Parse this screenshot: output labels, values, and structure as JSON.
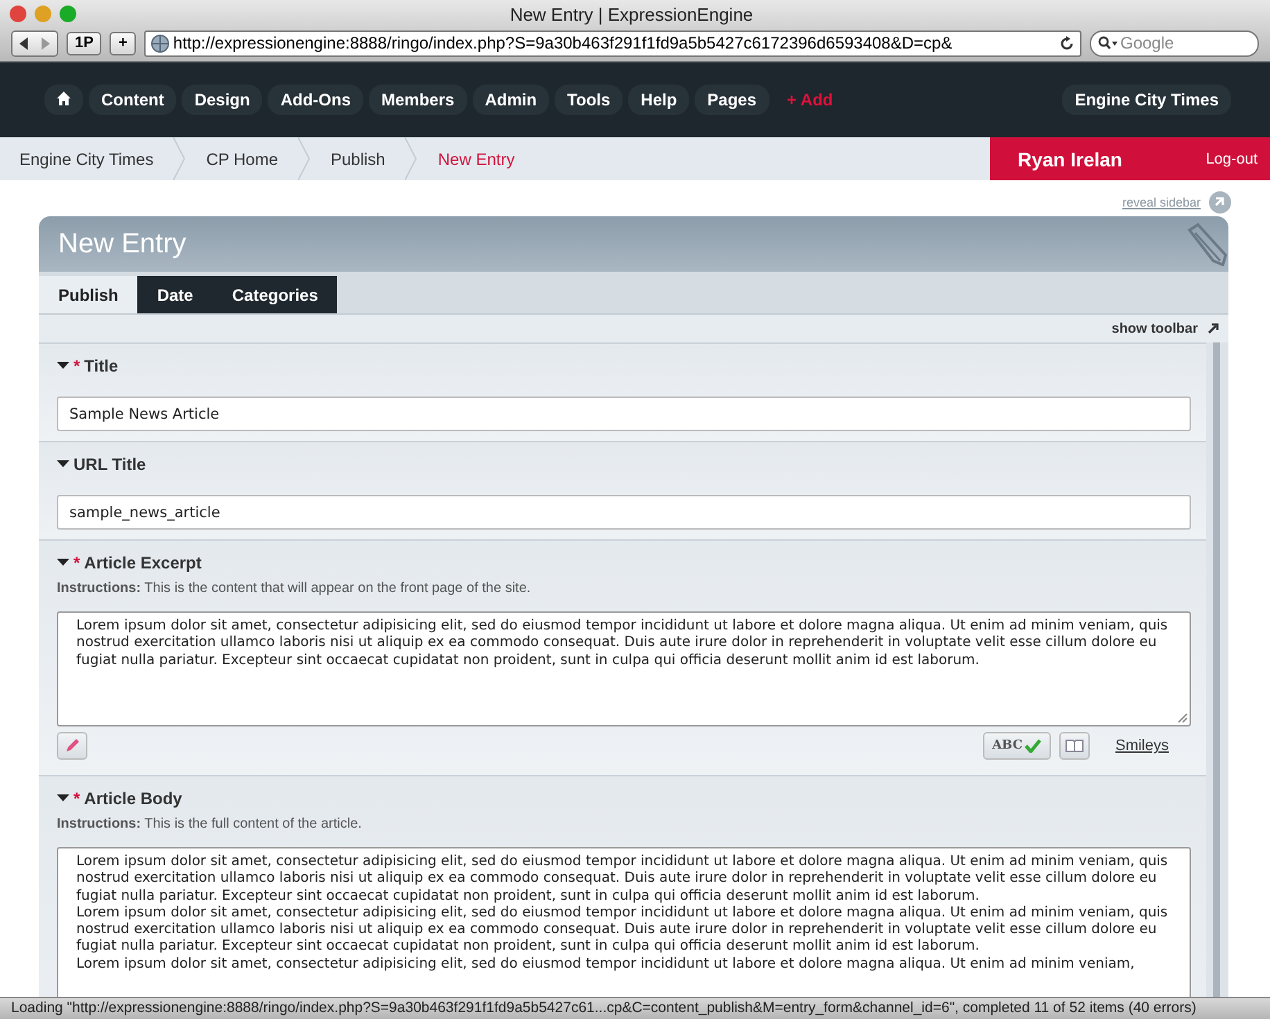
{
  "window": {
    "title": "New Entry | ExpressionEngine",
    "url": "http://expressionengine:8888/ringo/index.php?S=9a30b463f291f1fd9a5b5427c6172396d6593408&D=cp&",
    "bookmark": "1P",
    "plus": "+",
    "search_placeholder": "Google"
  },
  "nav": {
    "items": [
      {
        "kind": "home"
      },
      {
        "kind": "link",
        "label": "Content"
      },
      {
        "kind": "link",
        "label": "Design"
      },
      {
        "kind": "link",
        "label": "Add-Ons"
      },
      {
        "kind": "link",
        "label": "Members"
      },
      {
        "kind": "link",
        "label": "Admin"
      },
      {
        "kind": "link",
        "label": "Tools"
      },
      {
        "kind": "link",
        "label": "Help"
      },
      {
        "kind": "link",
        "label": "Pages"
      },
      {
        "kind": "add",
        "label": "+ Add"
      }
    ],
    "site": "Engine City Times"
  },
  "breadcrumbs": [
    {
      "label": "Engine City Times",
      "selected": false
    },
    {
      "label": "CP Home",
      "selected": false
    },
    {
      "label": "Publish",
      "selected": false
    },
    {
      "label": "New Entry",
      "selected": true
    }
  ],
  "user": {
    "name": "Ryan Irelan",
    "logout": "Log-out"
  },
  "reveal_sidebar": "reveal sidebar",
  "panel": {
    "title": "New Entry",
    "tabs": [
      {
        "label": "Publish",
        "selected": true
      },
      {
        "label": "Date",
        "selected": false
      },
      {
        "label": "Categories",
        "selected": false
      }
    ],
    "show_toolbar": "show toolbar",
    "fields": [
      {
        "kind": "text",
        "label": "Title",
        "marker": "*",
        "value": "Sample News Article"
      },
      {
        "kind": "text",
        "label": "URL Title",
        "value": "sample_news_article"
      },
      {
        "kind": "textarea",
        "label": "Article Excerpt",
        "marker": "*",
        "instructions": "**Instructions:**  This is the content that will appear on the front page of the site.",
        "paragraphs": [
          "Lorem ipsum dolor sit amet, consectetur adipisicing elit, sed do eiusmod tempor incididunt ut labore et dolore magna aliqua. Ut enim ad minim veniam, quis nostrud exercitation ullamco laboris nisi ut aliquip ex ea commodo consequat. Duis aute irure dolor in reprehenderit in voluptate velit esse cillum dolore eu fugiat nulla pariatur. Excepteur sint occaecat cupidatat non proident, sunt in culpa qui officia deserunt mollit anim id est laborum."
        ],
        "spellcheck": "ABC",
        "smileys": "Smileys"
      },
      {
        "kind": "textarea",
        "label": "Article Body",
        "marker": "*",
        "instructions": "**Instructions:**  This is the full content of the article.",
        "paragraphs": [
          "Lorem ipsum dolor sit amet, consectetur adipisicing elit, sed do eiusmod tempor incididunt ut labore et dolore magna aliqua. Ut enim ad minim veniam, quis nostrud exercitation ullamco laboris nisi ut aliquip ex ea commodo consequat. Duis aute irure dolor in reprehenderit in voluptate velit esse cillum dolore eu fugiat nulla pariatur. Excepteur sint occaecat cupidatat non proident, sunt in culpa qui officia deserunt mollit anim id est laborum.",
          "Lorem ipsum dolor sit amet, consectetur adipisicing elit, sed do eiusmod tempor incididunt ut labore et dolore magna aliqua. Ut enim ad minim veniam, quis nostrud exercitation ullamco laboris nisi ut aliquip ex ea commodo consequat. Duis aute irure dolor in reprehenderit in voluptate velit esse cillum dolore eu fugiat nulla pariatur. Excepteur sint occaecat cupidatat non proident, sunt in culpa qui officia deserunt mollit anim id est laborum.",
          "Lorem ipsum dolor sit amet, consectetur adipisicing elit, sed do eiusmod tempor incididunt ut labore et dolore magna aliqua. Ut enim ad minim veniam,"
        ]
      }
    ]
  },
  "status_bar": "Loading \"http://expressionengine:8888/ringo/index.php?S=9a30b463f291f1fd9a5b5427c61...cp&C=content_publish&M=entry_form&channel_id=6\", completed 11 of 52 items (40 errors)"
}
